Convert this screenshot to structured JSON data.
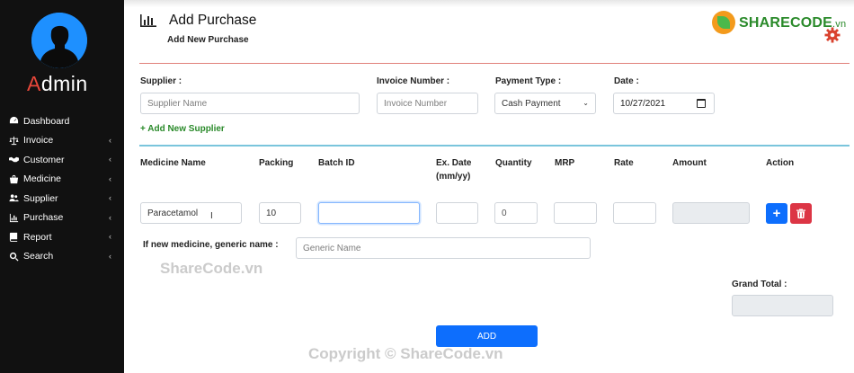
{
  "sidebar": {
    "brand_first": "A",
    "brand_rest": "dmin",
    "items": [
      {
        "label": "Dashboard",
        "icon": "dashboard-icon",
        "has_submenu": false
      },
      {
        "label": "Invoice",
        "icon": "scale-icon",
        "has_submenu": true
      },
      {
        "label": "Customer",
        "icon": "handshake-icon",
        "has_submenu": true
      },
      {
        "label": "Medicine",
        "icon": "shopping-bag-icon",
        "has_submenu": true
      },
      {
        "label": "Supplier",
        "icon": "users-icon",
        "has_submenu": true
      },
      {
        "label": "Purchase",
        "icon": "bar-chart-icon",
        "has_submenu": true
      },
      {
        "label": "Report",
        "icon": "book-icon",
        "has_submenu": true
      },
      {
        "label": "Search",
        "icon": "search-icon",
        "has_submenu": true
      }
    ],
    "chevron": "‹"
  },
  "header": {
    "title": "Add Purchase",
    "subtitle": "Add New Purchase",
    "logo_main": "SHARECODE",
    "logo_suffix": ".vn"
  },
  "form": {
    "supplier": {
      "label": "Supplier :",
      "placeholder": "Supplier Name"
    },
    "invoice": {
      "label": "Invoice Number :",
      "placeholder": "Invoice Number"
    },
    "payment": {
      "label": "Payment Type :",
      "value": "Cash Payment"
    },
    "date": {
      "label": "Date :",
      "value": "10/27/2021"
    },
    "add_supplier_label": "+ Add New Supplier"
  },
  "table": {
    "headers": {
      "medicine": "Medicine Name",
      "packing": "Packing",
      "batch": "Batch ID",
      "expiry_1": "Ex. Date",
      "expiry_2": "(mm/yy)",
      "quantity": "Quantity",
      "mrp": "MRP",
      "rate": "Rate",
      "amount": "Amount",
      "action": "Action"
    },
    "row": {
      "medicine": "Paracetamol",
      "packing": "10",
      "batch": "",
      "expiry": "",
      "quantity": "0",
      "mrp": "",
      "rate": "",
      "amount": ""
    },
    "generic_label": "If new medicine, generic name :",
    "generic_placeholder": "Generic Name",
    "plus_label": "+"
  },
  "totals": {
    "grand_total_label": "Grand Total :",
    "grand_total_value": ""
  },
  "actions": {
    "add_label": "ADD"
  },
  "watermarks": {
    "text1": "ShareCode.vn",
    "text2": "Copyright © ShareCode.vn"
  },
  "colors": {
    "sidebar_bg": "#111111",
    "brand_accent": "#e8473a",
    "primary": "#0d6efd",
    "danger": "#dc3545",
    "success": "#2a8a2a"
  }
}
